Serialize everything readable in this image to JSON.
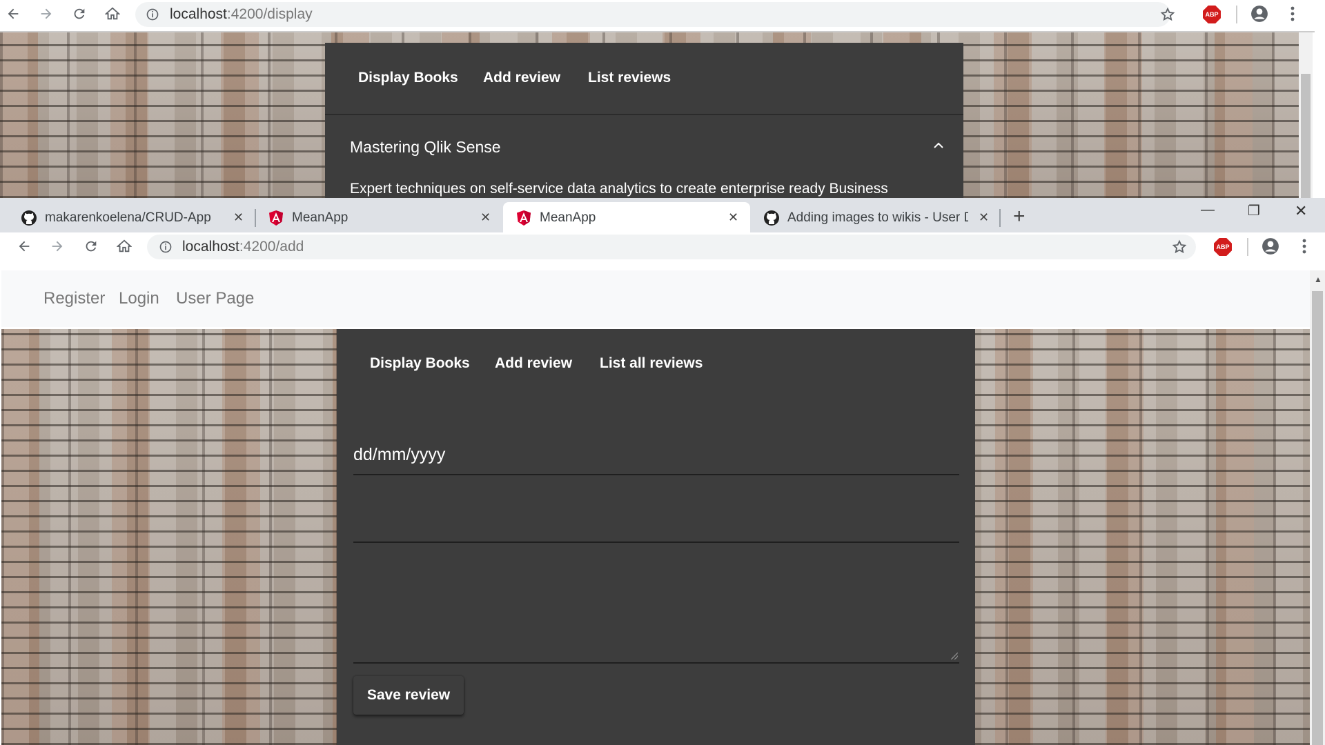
{
  "window_back": {
    "url_host": "localhost",
    "url_path": ":4200/display",
    "nav_links": [
      "Display Books",
      "Add review",
      "List reviews"
    ],
    "book_title": "Mastering Qlik Sense",
    "book_description": "Expert techniques on self-service data analytics to create enterprise ready Business",
    "adblock_label": "ABP"
  },
  "window_front": {
    "tabs": [
      {
        "title": "makarenkoelena/CRUD-App",
        "icon": "github-icon",
        "active": false
      },
      {
        "title": "MeanApp",
        "icon": "angular-icon",
        "active": false
      },
      {
        "title": "MeanApp",
        "icon": "angular-icon",
        "active": true
      },
      {
        "title": "Adding images to wikis - User Do",
        "icon": "github-icon",
        "active": false
      }
    ],
    "url_host": "localhost",
    "url_path": ":4200/add",
    "adblock_label": "ABP",
    "top_nav": [
      "Register",
      "Login",
      "User Page"
    ],
    "panel_nav": [
      "Display Books",
      "Add review",
      "List all reviews"
    ],
    "form": {
      "date_value": "dd/mm/yyyy",
      "title_value": "",
      "review_value": "",
      "save_label": "Save review"
    }
  },
  "colors": {
    "panel_bg": "#3d3d3d",
    "tabstrip_bg": "#dee1e6",
    "adblock_red": "#d21c1c",
    "navbar_bg": "#f8f9fa"
  }
}
